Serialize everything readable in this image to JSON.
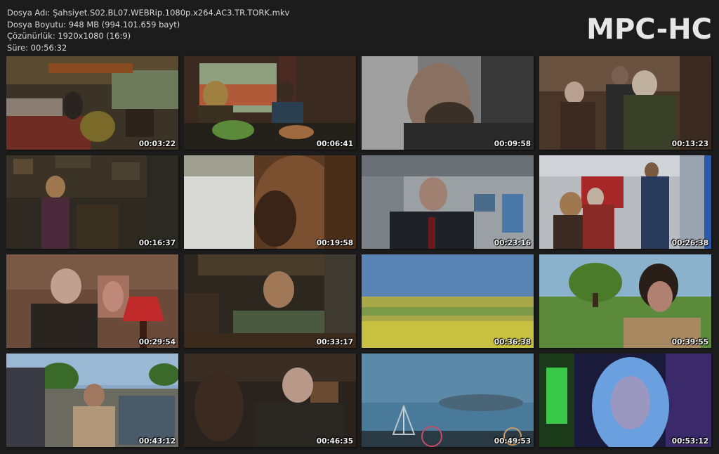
{
  "info": {
    "file_name": "Dosya Adı: Şahsiyet.S02.BL07.WEBRip.1080p.x264.AC3.TR.TORK.mkv",
    "file_size": "Dosya Boyutu: 948 MB (994.101.659 bayt)",
    "resolution": "Çözünürlük: 1920x1080 (16:9)",
    "duration": "Süre: 00:56:32"
  },
  "logo": "MPC-HC",
  "thumbnails": [
    {
      "time": "00:03:22"
    },
    {
      "time": "00:06:41"
    },
    {
      "time": "00:09:58"
    },
    {
      "time": "00:13:23"
    },
    {
      "time": "00:16:37"
    },
    {
      "time": "00:19:58"
    },
    {
      "time": "00:23:16"
    },
    {
      "time": "00:26:38"
    },
    {
      "time": "00:29:54"
    },
    {
      "time": "00:33:17"
    },
    {
      "time": "00:36:38"
    },
    {
      "time": "00:39:55"
    },
    {
      "time": "00:43:12"
    },
    {
      "time": "00:46:35"
    },
    {
      "time": "00:49:53"
    },
    {
      "time": "00:53:12"
    }
  ]
}
